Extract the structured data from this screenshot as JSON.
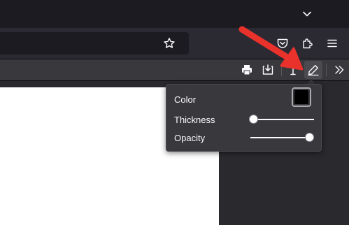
{
  "popup": {
    "color_label": "Color",
    "thickness_label": "Thickness",
    "opacity_label": "Opacity",
    "color_value": "#000000",
    "thickness_value": 0.05,
    "opacity_value": 1.0
  },
  "icons": {
    "tab_list": "chevron-down-icon",
    "bookmark": "star-icon",
    "pocket": "pocket-icon",
    "extensions": "puzzle-icon",
    "menu": "hamburger-icon",
    "print": "printer-icon",
    "save": "download-icon",
    "text": "text-cursor-icon",
    "draw": "pencil-icon",
    "more": "double-chevron-right-icon"
  },
  "colors": {
    "annotation_arrow": "#e8322b"
  }
}
